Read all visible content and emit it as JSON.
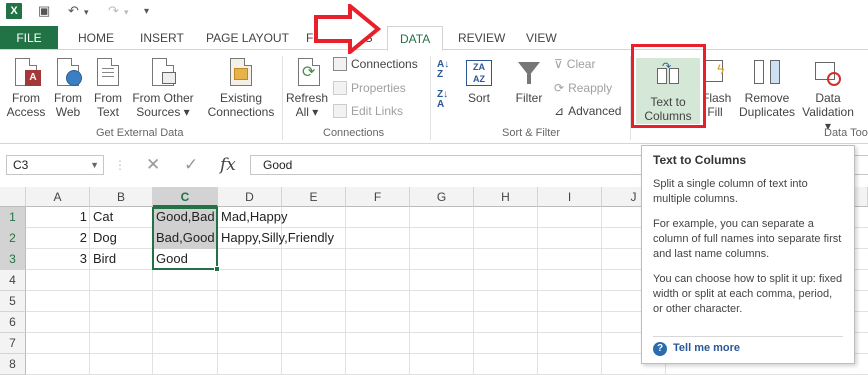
{
  "tabs": {
    "file": "FILE",
    "home": "HOME",
    "insert": "INSERT",
    "page_layout": "PAGE LAYOUT",
    "formulas": "FORMULAS",
    "data": "DATA",
    "review": "REVIEW",
    "view": "VIEW"
  },
  "ribbon": {
    "get_external": {
      "from_access": [
        "From",
        "Access"
      ],
      "from_web": [
        "From",
        "Web"
      ],
      "from_text": [
        "From",
        "Text"
      ],
      "from_other": [
        "From Other",
        "Sources ▾"
      ],
      "existing": [
        "Existing",
        "Connections"
      ],
      "label": "Get External Data"
    },
    "connections": {
      "refresh": [
        "Refresh",
        "All ▾"
      ],
      "connections": "Connections",
      "properties": "Properties",
      "edit_links": "Edit Links",
      "label": "Connections"
    },
    "sort_filter": {
      "sort": "Sort",
      "filter": "Filter",
      "clear": "Clear",
      "reapply": "Reapply",
      "advanced": "Advanced",
      "label": "Sort & Filter"
    },
    "data_tools": {
      "text_to_columns": [
        "Text to",
        "Columns"
      ],
      "flash_fill": [
        "Flash",
        "Fill"
      ],
      "remove_duplicates": [
        "Remove",
        "Duplicates"
      ],
      "data_validation": [
        "Data",
        "Validation ▾"
      ],
      "label": "Data Too"
    }
  },
  "formula_bar": {
    "name_box": "C3",
    "fx": "fx",
    "value": "Good"
  },
  "grid": {
    "columns": [
      "A",
      "B",
      "C",
      "D",
      "E",
      "F",
      "G",
      "H",
      "I",
      "J"
    ],
    "rows": [
      "1",
      "2",
      "3",
      "4",
      "5",
      "6",
      "7",
      "8"
    ],
    "cells": {
      "A1": "1",
      "B1": "Cat",
      "C1": "Good,Bad",
      "D1": "Mad,Happy",
      "A2": "2",
      "B2": "Dog",
      "C2": "Bad,Good",
      "D2": "Happy,Silly,Friendly",
      "A3": "3",
      "B3": "Bird",
      "C3": "Good"
    },
    "selected_column": "C"
  },
  "tooltip": {
    "title": "Text to Columns",
    "p1": "Split a single column of text into multiple columns.",
    "p2": "For example, you can separate a column of full names into separate first and last name columns.",
    "p3": "You can choose how to split it up: fixed width or split at each comma, period, or other character.",
    "tell_me": "Tell me more"
  },
  "colors": {
    "excel_green": "#217346",
    "annotation_red": "#e8202a"
  }
}
